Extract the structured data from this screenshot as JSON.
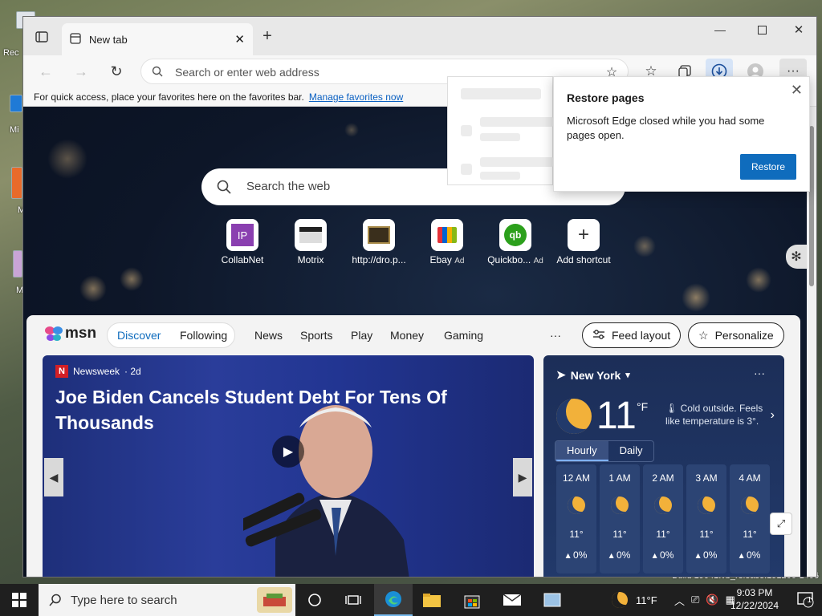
{
  "desktop": {
    "labels": [
      "Rec",
      "Mi",
      "M",
      "M"
    ],
    "build_text": "Build 19041.vb_release.191206-1406"
  },
  "browser": {
    "tab_title": "New tab",
    "address_placeholder": "Search or enter web address",
    "favbar_text": "For quick access, place your favorites here on the favorites bar.",
    "favbar_link": "Manage favorites now"
  },
  "restore": {
    "title": "Restore pages",
    "body": "Microsoft Edge closed while you had some pages open.",
    "button": "Restore"
  },
  "ntp": {
    "search_placeholder": "Search the web",
    "tiles": [
      {
        "label": "CollabNet",
        "ad": "",
        "icon": "collabnet-icon"
      },
      {
        "label": "Motrix",
        "ad": "",
        "icon": "motrix-icon"
      },
      {
        "label": "http://dro.p...",
        "ad": "",
        "icon": "site-icon"
      },
      {
        "label": "Ebay",
        "ad": "Ad",
        "icon": "ebay-icon"
      },
      {
        "label": "Quickbo...",
        "ad": "Ad",
        "icon": "quickbooks-icon"
      },
      {
        "label": "Add shortcut",
        "ad": "",
        "icon": "plus-icon"
      }
    ]
  },
  "msn": {
    "logo": "msn",
    "tabs": [
      "Discover",
      "Following"
    ],
    "nav": [
      "News",
      "Sports",
      "Play",
      "Money",
      "Gaming"
    ],
    "more": "···",
    "feed_layout": "Feed layout",
    "personalize": "Personalize",
    "hero": {
      "source": "Newsweek",
      "age": "· 2d",
      "headline": "Joe Biden Cancels Student Debt For Tens Of Thousands"
    },
    "weather": {
      "location": "New York",
      "temp": "11",
      "unit": "°F",
      "description": "Cold outside. Feels like temperature is 3°.",
      "toggle": [
        "Hourly",
        "Daily"
      ],
      "hours": [
        {
          "time": "12 AM",
          "temp": "11°",
          "precip": "0%"
        },
        {
          "time": "1 AM",
          "temp": "11°",
          "precip": "0%"
        },
        {
          "time": "2 AM",
          "temp": "11°",
          "precip": "0%"
        },
        {
          "time": "3 AM",
          "temp": "11°",
          "precip": "0%"
        },
        {
          "time": "4 AM",
          "temp": "11°",
          "precip": "0%"
        }
      ]
    }
  },
  "taskbar": {
    "search_placeholder": "Type here to search",
    "weather_temp": "11°F",
    "time": "9:03 PM",
    "date": "12/22/2024",
    "notifications": "1"
  },
  "colors": {
    "accent": "#0f6cbd",
    "taskbar": "#1f1f1f",
    "weather_bg": "#223a6b"
  }
}
